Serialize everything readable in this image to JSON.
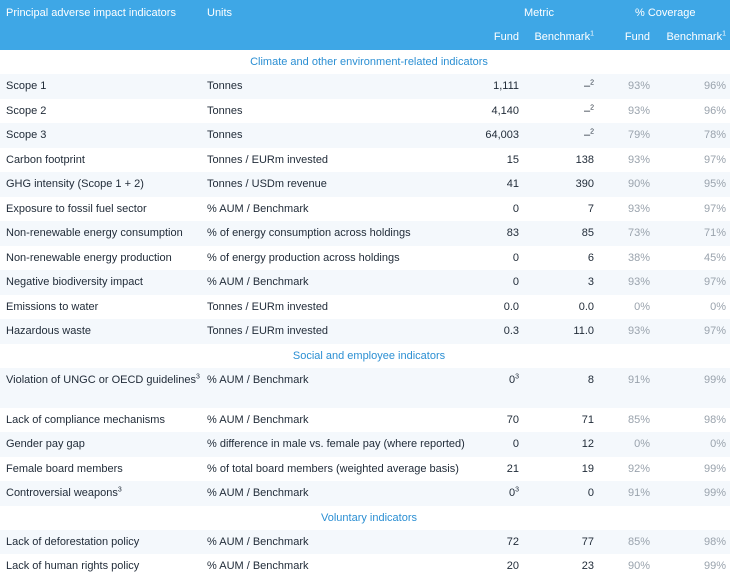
{
  "header": {
    "indicator_label": "Principal adverse impact indicators",
    "units_label": "Units",
    "metric_label": "Metric",
    "coverage_label": "% Coverage",
    "fund_label": "Fund",
    "benchmark_label": "Benchmark",
    "benchmark_sup": "1",
    "cov_fund_label": "Fund",
    "cov_benchmark_label": "Benchmark",
    "cov_benchmark_sup": "1"
  },
  "sections": [
    {
      "title": "Climate and other environment-related indicators",
      "rows": [
        {
          "name": "Scope 1",
          "unit": "Tonnes",
          "fund": "1,111",
          "bench": "–",
          "bench_sup": "2",
          "cf": "93%",
          "cb": "96%"
        },
        {
          "name": "Scope 2",
          "unit": "Tonnes",
          "fund": "4,140",
          "bench": "–",
          "bench_sup": "2",
          "cf": "93%",
          "cb": "96%"
        },
        {
          "name": "Scope 3",
          "unit": "Tonnes",
          "fund": "64,003",
          "bench": "–",
          "bench_sup": "2",
          "cf": "79%",
          "cb": "78%"
        },
        {
          "name": "Carbon footprint",
          "unit": "Tonnes / EURm invested",
          "fund": "15",
          "bench": "138",
          "cf": "93%",
          "cb": "97%"
        },
        {
          "name": "GHG intensity (Scope 1 + 2)",
          "unit": "Tonnes / USDm revenue",
          "fund": "41",
          "bench": "390",
          "cf": "90%",
          "cb": "95%"
        },
        {
          "name": "Exposure to fossil fuel sector",
          "unit": "% AUM / Benchmark",
          "fund": "0",
          "bench": "7",
          "cf": "93%",
          "cb": "97%"
        },
        {
          "name": "Non-renewable energy consumption",
          "unit": "% of energy consumption across holdings",
          "fund": "83",
          "bench": "85",
          "cf": "73%",
          "cb": "71%"
        },
        {
          "name": "Non-renewable energy production",
          "unit": "% of energy production across holdings",
          "fund": "0",
          "bench": "6",
          "cf": "38%",
          "cb": "45%"
        },
        {
          "name": "Negative biodiversity impact",
          "unit": "% AUM / Benchmark",
          "fund": "0",
          "bench": "3",
          "cf": "93%",
          "cb": "97%"
        },
        {
          "name": "Emissions to water",
          "unit": "Tonnes / EURm invested",
          "fund": "0.0",
          "bench": "0.0",
          "cf": "0%",
          "cb": "0%"
        },
        {
          "name": "Hazardous waste",
          "unit": "Tonnes / EURm invested",
          "fund": "0.3",
          "bench": "11.0",
          "cf": "93%",
          "cb": "97%"
        }
      ]
    },
    {
      "title": "Social and employee indicators",
      "rows": [
        {
          "name": "Violation of UNGC or OECD guidelines",
          "name_sup": "3",
          "unit": "% AUM / Benchmark",
          "fund": "0",
          "fund_sup": "3",
          "bench": "8",
          "cf": "91%",
          "cb": "99%",
          "tall": true
        },
        {
          "name": "Lack of compliance mechanisms",
          "unit": "% AUM / Benchmark",
          "fund": "70",
          "bench": "71",
          "cf": "85%",
          "cb": "98%"
        },
        {
          "name": "Gender pay gap",
          "unit": "% difference in male vs. female pay (where reported)",
          "fund": "0",
          "bench": "12",
          "cf": "0%",
          "cb": "0%"
        },
        {
          "name": "Female board members",
          "unit": "% of total board members (weighted average basis)",
          "fund": "21",
          "bench": "19",
          "cf": "92%",
          "cb": "99%"
        },
        {
          "name": "Controversial weapons",
          "name_sup": "3",
          "unit": "% AUM / Benchmark",
          "fund": "0",
          "fund_sup": "3",
          "bench": "0",
          "cf": "91%",
          "cb": "99%"
        }
      ]
    },
    {
      "title": "Voluntary indicators",
      "rows": [
        {
          "name": "Lack of deforestation policy",
          "unit": "% AUM / Benchmark",
          "fund": "72",
          "bench": "77",
          "cf": "85%",
          "cb": "98%"
        },
        {
          "name": "Lack of human rights policy",
          "unit": "% AUM / Benchmark",
          "fund": "20",
          "bench": "23",
          "cf": "90%",
          "cb": "99%"
        }
      ]
    }
  ]
}
